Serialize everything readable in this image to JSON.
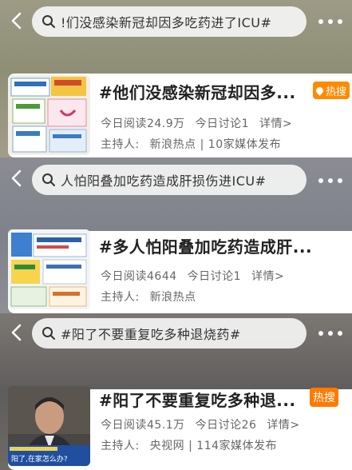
{
  "panels": [
    {
      "search_text": "!们没感染新冠却因多吃药进了ICU#",
      "title": "#他们没感染新冠却因多...",
      "badge": "热搜",
      "badge_color": "#ff8a00",
      "reads": "今日阅读24.9万",
      "discussions": "今日讨论1",
      "details": "详情>",
      "host_label": "主持人:",
      "host": "新浪热点 | 10家媒体发布"
    },
    {
      "search_text": "人怕阳叠加吃药造成肝损伤进ICU#",
      "title": "#多人怕阳叠加吃药造成肝...",
      "badge": "",
      "reads": "今日阅读4644",
      "discussions": "今日讨论1",
      "details": "详情>",
      "host_label": "主持人:",
      "host": "新浪热点"
    },
    {
      "search_text": "#阳了不要重复吃多种退烧药#",
      "title": "#阳了不要重复吃多种退...",
      "badge": "热搜",
      "badge_color": "#ff7a00",
      "reads": "今日阅读45.1万",
      "discussions": "今日讨论26",
      "details": "详情>",
      "host_label": "主持人:",
      "host": "央视网 | 114家媒体发布",
      "thumb_caption": "阳了,在家怎么办?"
    }
  ],
  "icons": {
    "back": "chevron-left-icon",
    "search": "search-icon",
    "more": "more-dots-icon"
  }
}
